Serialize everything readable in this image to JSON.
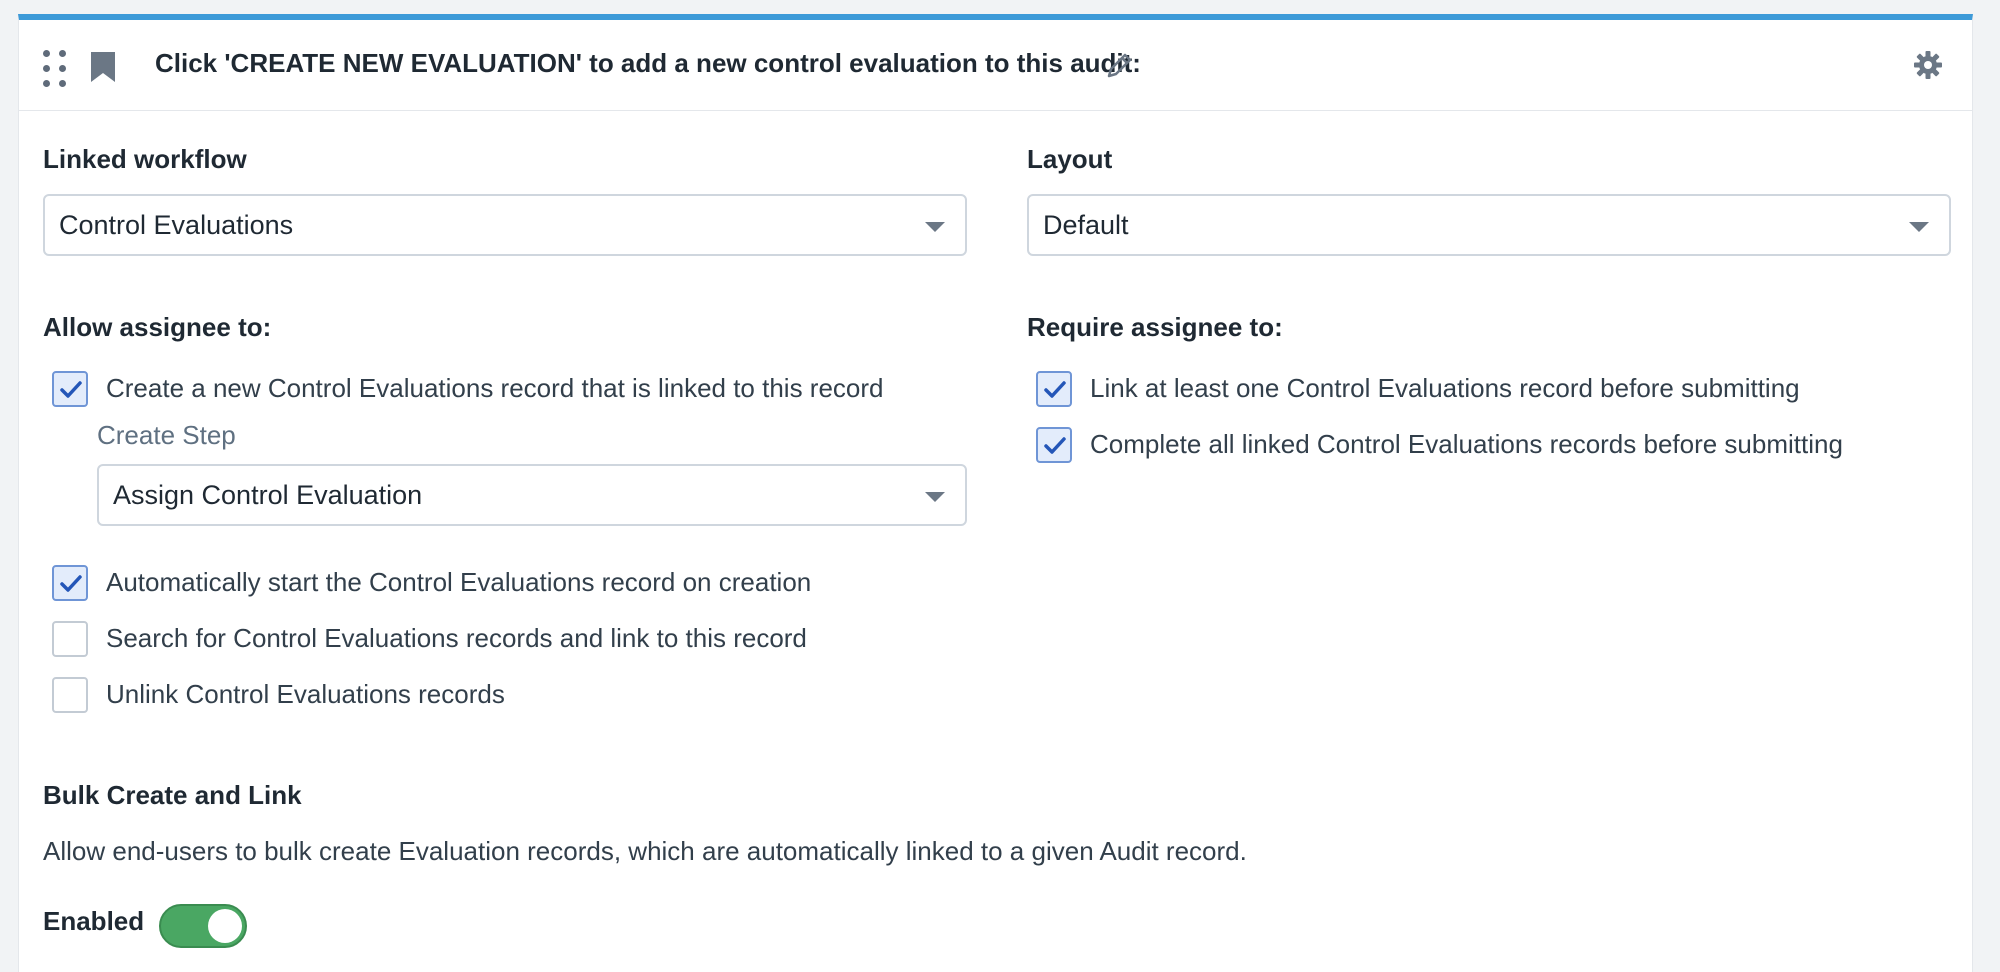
{
  "header": {
    "title": "Click 'CREATE NEW EVALUATION' to add a new control evaluation to this audit:"
  },
  "linked_workflow": {
    "label": "Linked workflow",
    "value": "Control Evaluations"
  },
  "layout": {
    "label": "Layout",
    "value": "Default"
  },
  "allow": {
    "label": "Allow assignee to:",
    "items": [
      {
        "label": "Create a new Control Evaluations record that is linked to this record",
        "checked": true
      },
      {
        "label": "Automatically start the Control Evaluations record on creation",
        "checked": true
      },
      {
        "label": "Search for Control Evaluations records and link to this record",
        "checked": false
      },
      {
        "label": "Unlink Control Evaluations records",
        "checked": false
      }
    ],
    "create_step": {
      "label": "Create Step",
      "value": "Assign Control Evaluation"
    }
  },
  "require": {
    "label": "Require assignee to:",
    "items": [
      {
        "label": "Link at least one Control Evaluations record before submitting",
        "checked": true
      },
      {
        "label": "Complete all linked Control Evaluations records before submitting",
        "checked": true
      }
    ]
  },
  "bulk": {
    "title": "Bulk Create and Link",
    "description": "Allow end-users to bulk create Evaluation records, which are automatically linked to a given Audit record.",
    "enabled_label": "Enabled",
    "enabled": true
  },
  "colors": {
    "accent_bar": "#3d9ad8",
    "checkbox_checked": "#2456b8",
    "toggle_on": "#4aa763"
  },
  "icons": [
    "drag-handle-icon",
    "bookmark-icon",
    "pencil-icon",
    "gear-icon",
    "chevron-down-icon",
    "checkmark-icon"
  ]
}
